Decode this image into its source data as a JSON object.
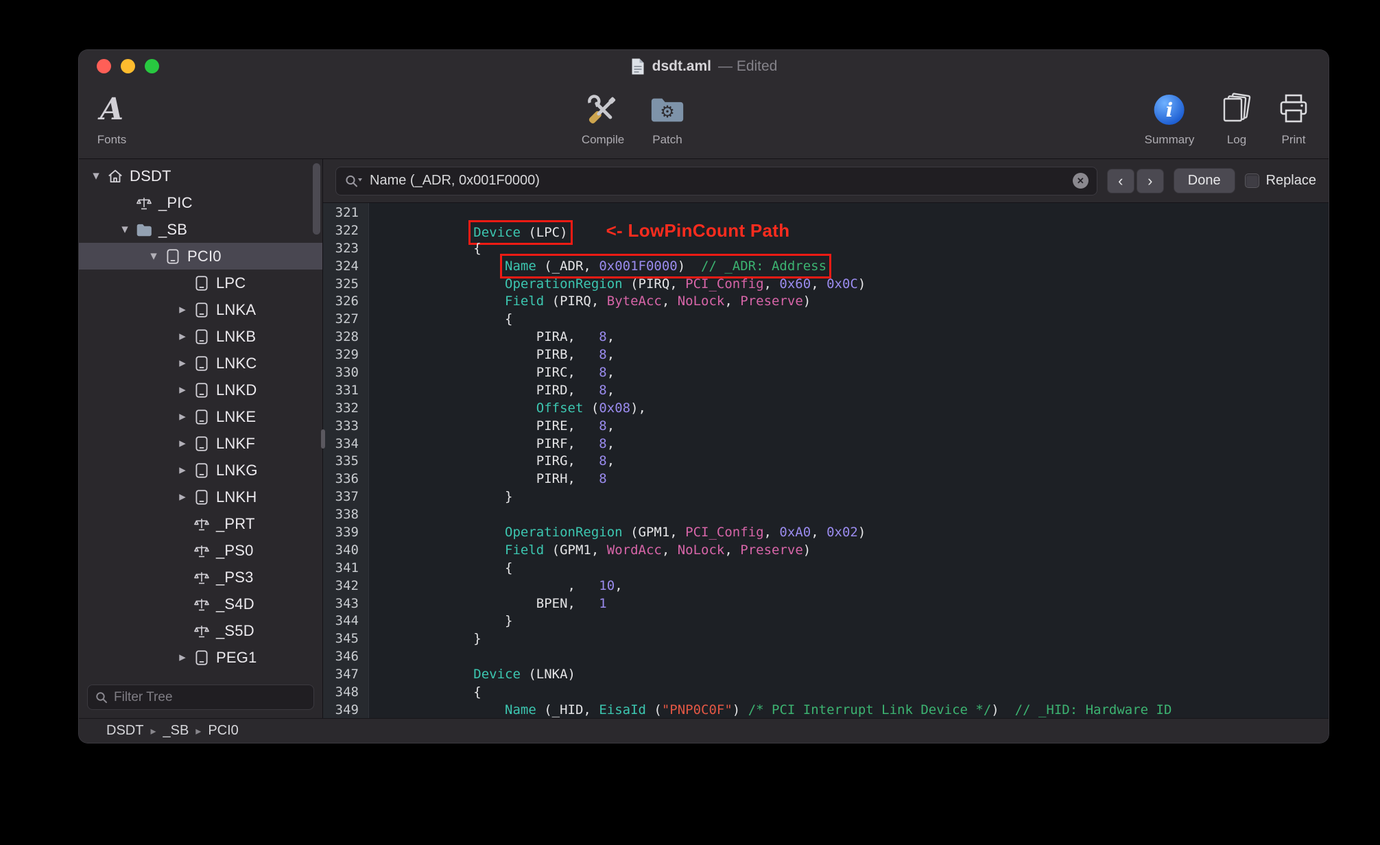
{
  "window": {
    "title": "dsdt.aml",
    "edited_suffix": "— Edited"
  },
  "toolbar": {
    "fonts_label": "Fonts",
    "compile_label": "Compile",
    "patch_label": "Patch",
    "summary_label": "Summary",
    "log_label": "Log",
    "print_label": "Print"
  },
  "sidebar": {
    "filter_placeholder": "Filter Tree",
    "tree": [
      {
        "label": "DSDT",
        "icon": "house",
        "level": 0,
        "disclosure": "open"
      },
      {
        "label": "_PIC",
        "icon": "method",
        "level": 1,
        "disclosure": "none"
      },
      {
        "label": "_SB",
        "icon": "folder",
        "level": 1,
        "disclosure": "open"
      },
      {
        "label": "PCI0",
        "icon": "device",
        "level": 2,
        "disclosure": "open",
        "selected": true
      },
      {
        "label": "LPC",
        "icon": "device",
        "level": 3,
        "disclosure": "none"
      },
      {
        "label": "LNKA",
        "icon": "device",
        "level": 3,
        "disclosure": "closed"
      },
      {
        "label": "LNKB",
        "icon": "device",
        "level": 3,
        "disclosure": "closed"
      },
      {
        "label": "LNKC",
        "icon": "device",
        "level": 3,
        "disclosure": "closed"
      },
      {
        "label": "LNKD",
        "icon": "device",
        "level": 3,
        "disclosure": "closed"
      },
      {
        "label": "LNKE",
        "icon": "device",
        "level": 3,
        "disclosure": "closed"
      },
      {
        "label": "LNKF",
        "icon": "device",
        "level": 3,
        "disclosure": "closed"
      },
      {
        "label": "LNKG",
        "icon": "device",
        "level": 3,
        "disclosure": "closed"
      },
      {
        "label": "LNKH",
        "icon": "device",
        "level": 3,
        "disclosure": "closed"
      },
      {
        "label": "_PRT",
        "icon": "method",
        "level": 3,
        "disclosure": "none"
      },
      {
        "label": "_PS0",
        "icon": "method",
        "level": 3,
        "disclosure": "none"
      },
      {
        "label": "_PS3",
        "icon": "method",
        "level": 3,
        "disclosure": "none"
      },
      {
        "label": "_S4D",
        "icon": "method",
        "level": 3,
        "disclosure": "none"
      },
      {
        "label": "_S5D",
        "icon": "method",
        "level": 3,
        "disclosure": "none"
      },
      {
        "label": "PEG1",
        "icon": "device",
        "level": 3,
        "disclosure": "closed"
      }
    ]
  },
  "search": {
    "query": "Name (_ADR, 0x001F0000)",
    "nav_prev": "‹",
    "nav_next": "›",
    "done_label": "Done",
    "replace_label": "Replace",
    "clear_glyph": "✕"
  },
  "statusbar": {
    "items": [
      "DSDT",
      "_SB",
      "PCI0"
    ],
    "separator": "▸"
  },
  "editor": {
    "annotation": "<- LowPinCount Path",
    "colors": {
      "keyword": "#3cc6b0",
      "number": "#9a8bee",
      "predefined": "#d765a8",
      "string": "#e25744",
      "comment": "#3cb371",
      "annotation_red": "#fb2c1e",
      "highlight_box": "#f01b14",
      "selection_gray": "#494751"
    },
    "lines": [
      {
        "n": 321,
        "t": []
      },
      {
        "n": 322,
        "annot": true,
        "t": [
          [
            "plain",
            "            "
          ],
          [
            "kw",
            "Device",
            1
          ],
          [
            "plain",
            " (LPC)",
            1
          ]
        ]
      },
      {
        "n": 323,
        "t": [
          [
            "plain",
            "            {"
          ]
        ]
      },
      {
        "n": 324,
        "t": [
          [
            "plain",
            "                "
          ],
          [
            "kw",
            "Name",
            1
          ],
          [
            "plain",
            " (_ADR, ",
            1
          ],
          [
            "num",
            "0x001F0000",
            1
          ],
          [
            "plain",
            ")  ",
            1
          ],
          [
            "comment",
            "// _ADR: Address",
            1
          ]
        ]
      },
      {
        "n": 325,
        "t": [
          [
            "plain",
            "                "
          ],
          [
            "kw",
            "OperationRegion"
          ],
          [
            "plain",
            " (PIRQ, "
          ],
          [
            "predef",
            "PCI_Config"
          ],
          [
            "plain",
            ", "
          ],
          [
            "num",
            "0x60"
          ],
          [
            "plain",
            ", "
          ],
          [
            "num",
            "0x0C"
          ],
          [
            "plain",
            ")"
          ]
        ]
      },
      {
        "n": 326,
        "t": [
          [
            "plain",
            "                "
          ],
          [
            "kw",
            "Field"
          ],
          [
            "plain",
            " (PIRQ, "
          ],
          [
            "predef",
            "ByteAcc"
          ],
          [
            "plain",
            ", "
          ],
          [
            "predef",
            "NoLock"
          ],
          [
            "plain",
            ", "
          ],
          [
            "predef",
            "Preserve"
          ],
          [
            "plain",
            ")"
          ]
        ]
      },
      {
        "n": 327,
        "t": [
          [
            "plain",
            "                {"
          ]
        ]
      },
      {
        "n": 328,
        "t": [
          [
            "plain",
            "                    PIRA,   "
          ],
          [
            "num",
            "8"
          ],
          [
            "plain",
            ","
          ]
        ]
      },
      {
        "n": 329,
        "t": [
          [
            "plain",
            "                    PIRB,   "
          ],
          [
            "num",
            "8"
          ],
          [
            "plain",
            ","
          ]
        ]
      },
      {
        "n": 330,
        "t": [
          [
            "plain",
            "                    PIRC,   "
          ],
          [
            "num",
            "8"
          ],
          [
            "plain",
            ","
          ]
        ]
      },
      {
        "n": 331,
        "t": [
          [
            "plain",
            "                    PIRD,   "
          ],
          [
            "num",
            "8"
          ],
          [
            "plain",
            ","
          ]
        ]
      },
      {
        "n": 332,
        "t": [
          [
            "plain",
            "                    "
          ],
          [
            "kw",
            "Offset"
          ],
          [
            "plain",
            " ("
          ],
          [
            "num",
            "0x08"
          ],
          [
            "plain",
            "),"
          ]
        ]
      },
      {
        "n": 333,
        "t": [
          [
            "plain",
            "                    PIRE,   "
          ],
          [
            "num",
            "8"
          ],
          [
            "plain",
            ","
          ]
        ]
      },
      {
        "n": 334,
        "t": [
          [
            "plain",
            "                    PIRF,   "
          ],
          [
            "num",
            "8"
          ],
          [
            "plain",
            ","
          ]
        ]
      },
      {
        "n": 335,
        "t": [
          [
            "plain",
            "                    PIRG,   "
          ],
          [
            "num",
            "8"
          ],
          [
            "plain",
            ","
          ]
        ]
      },
      {
        "n": 336,
        "t": [
          [
            "plain",
            "                    PIRH,   "
          ],
          [
            "num",
            "8"
          ]
        ]
      },
      {
        "n": 337,
        "t": [
          [
            "plain",
            "                }"
          ]
        ]
      },
      {
        "n": 338,
        "t": []
      },
      {
        "n": 339,
        "t": [
          [
            "plain",
            "                "
          ],
          [
            "kw",
            "OperationRegion"
          ],
          [
            "plain",
            " (GPM1, "
          ],
          [
            "predef",
            "PCI_Config"
          ],
          [
            "plain",
            ", "
          ],
          [
            "num",
            "0xA0"
          ],
          [
            "plain",
            ", "
          ],
          [
            "num",
            "0x02"
          ],
          [
            "plain",
            ")"
          ]
        ]
      },
      {
        "n": 340,
        "t": [
          [
            "plain",
            "                "
          ],
          [
            "kw",
            "Field"
          ],
          [
            "plain",
            " (GPM1, "
          ],
          [
            "predef",
            "WordAcc"
          ],
          [
            "plain",
            ", "
          ],
          [
            "predef",
            "NoLock"
          ],
          [
            "plain",
            ", "
          ],
          [
            "predef",
            "Preserve"
          ],
          [
            "plain",
            ")"
          ]
        ]
      },
      {
        "n": 341,
        "t": [
          [
            "plain",
            "                {"
          ]
        ]
      },
      {
        "n": 342,
        "t": [
          [
            "plain",
            "                        ,   "
          ],
          [
            "num",
            "10"
          ],
          [
            "plain",
            ","
          ]
        ]
      },
      {
        "n": 343,
        "t": [
          [
            "plain",
            "                    BPEN,   "
          ],
          [
            "num",
            "1"
          ]
        ]
      },
      {
        "n": 344,
        "t": [
          [
            "plain",
            "                }"
          ]
        ]
      },
      {
        "n": 345,
        "t": [
          [
            "plain",
            "            }"
          ]
        ]
      },
      {
        "n": 346,
        "t": []
      },
      {
        "n": 347,
        "t": [
          [
            "plain",
            "            "
          ],
          [
            "kw",
            "Device"
          ],
          [
            "plain",
            " (LNKA)"
          ]
        ]
      },
      {
        "n": 348,
        "t": [
          [
            "plain",
            "            {"
          ]
        ]
      },
      {
        "n": 349,
        "t": [
          [
            "plain",
            "                "
          ],
          [
            "kw",
            "Name"
          ],
          [
            "plain",
            " (_HID, "
          ],
          [
            "kw",
            "EisaId"
          ],
          [
            "plain",
            " ("
          ],
          [
            "str",
            "\"PNP0C0F\""
          ],
          [
            "plain",
            ") "
          ],
          [
            "comment",
            "/* PCI Interrupt Link Device */"
          ],
          [
            "plain",
            ")  "
          ],
          [
            "comment",
            "// _HID: Hardware ID"
          ]
        ]
      }
    ]
  }
}
